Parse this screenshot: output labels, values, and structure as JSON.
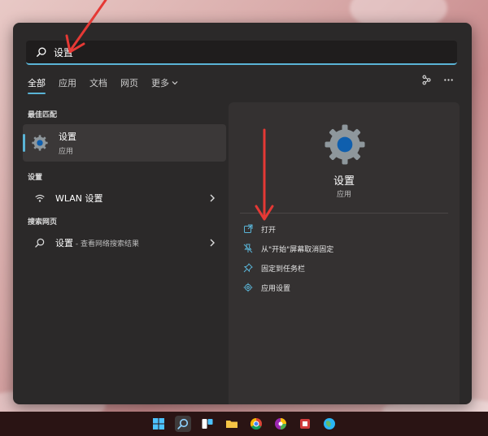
{
  "search": {
    "value": "设置",
    "placeholder": ""
  },
  "tabs": [
    {
      "label": "全部",
      "active": true
    },
    {
      "label": "应用",
      "active": false
    },
    {
      "label": "文档",
      "active": false
    },
    {
      "label": "网页",
      "active": false
    },
    {
      "label": "更多",
      "active": false
    }
  ],
  "sections": {
    "best_match": "最佳匹配",
    "settings": "设置",
    "web": "搜索网页"
  },
  "best_match_item": {
    "name": "设置",
    "type": "应用"
  },
  "settings_item": {
    "label": "WLAN 设置"
  },
  "web_item": {
    "label": "设置",
    "suffix": " - 查看网络搜索结果"
  },
  "preview": {
    "name": "设置",
    "type": "应用",
    "actions": [
      {
        "label": "打开",
        "icon": "open-icon"
      },
      {
        "label": "从\"开始\"屏幕取消固定",
        "icon": "unpin-icon"
      },
      {
        "label": "固定到任务栏",
        "icon": "pin-icon"
      },
      {
        "label": "应用设置",
        "icon": "gear-icon"
      }
    ]
  },
  "colors": {
    "accent": "#5ab4d6",
    "panel": "#2b2929",
    "annotation_arrow": "#e53935"
  }
}
